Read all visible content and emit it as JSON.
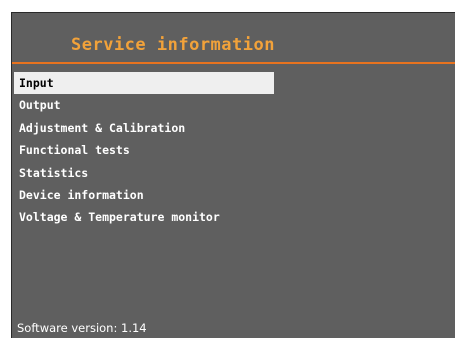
{
  "header": {
    "title": "Service information"
  },
  "menu": {
    "items": [
      {
        "label": "Input",
        "selected": true
      },
      {
        "label": "Output",
        "selected": false
      },
      {
        "label": "Adjustment & Calibration",
        "selected": false
      },
      {
        "label": "Functional tests",
        "selected": false
      },
      {
        "label": "Statistics",
        "selected": false
      },
      {
        "label": "Device information",
        "selected": false
      },
      {
        "label": "Voltage & Temperature monitor",
        "selected": false
      }
    ]
  },
  "footer": {
    "software_version": "Software version: 1.14"
  },
  "colors": {
    "background": "#5f5f5f",
    "title": "#f2a23a",
    "divider": "#e8731f",
    "selection": "#efefef"
  }
}
